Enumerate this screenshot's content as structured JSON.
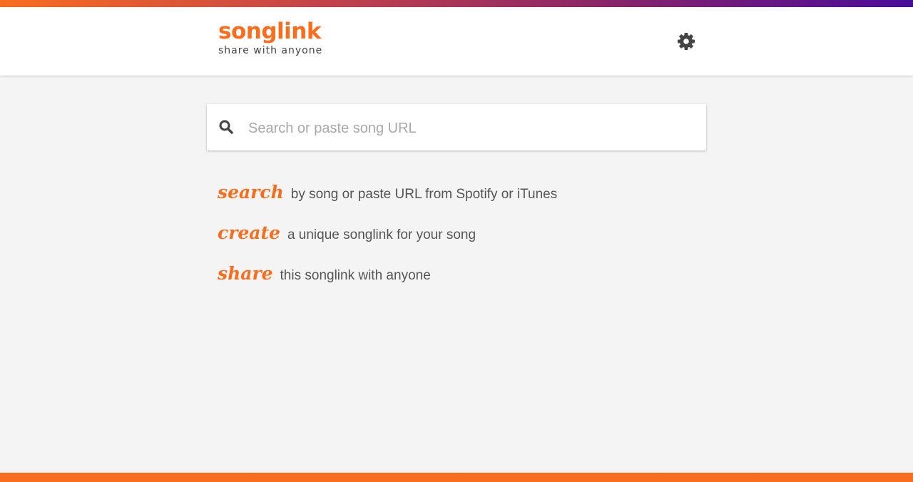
{
  "header": {
    "logo": "songlink",
    "tagline": "share with anyone",
    "settings_icon": "gear-icon"
  },
  "search": {
    "icon": "search-icon",
    "placeholder": "Search or paste song URL",
    "value": ""
  },
  "steps": [
    {
      "keyword": "search",
      "description": "by song or paste URL from Spotify or iTunes"
    },
    {
      "keyword": "create",
      "description": "a unique songlink for your song"
    },
    {
      "keyword": "share",
      "description": "this songlink with anyone"
    }
  ],
  "colors": {
    "accent": "#f96d1f",
    "gradient_end": "#4a0c99",
    "background": "#f4f4f4"
  }
}
